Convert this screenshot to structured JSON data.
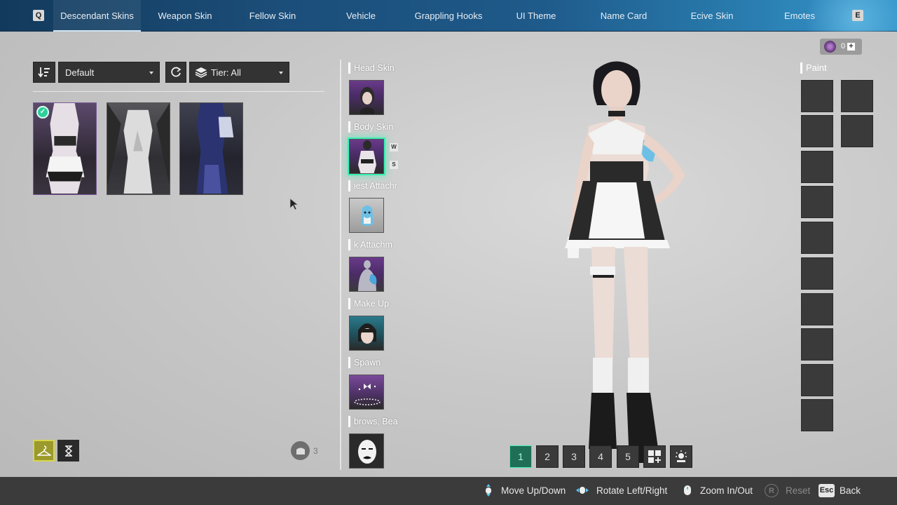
{
  "top_nav": {
    "left_key": "Q",
    "right_key": "E",
    "tabs": [
      {
        "label": "Descendant Skins",
        "active": true
      },
      {
        "label": "Weapon Skin",
        "active": false
      },
      {
        "label": "Fellow Skin",
        "active": false
      },
      {
        "label": "Vehicle",
        "active": false
      },
      {
        "label": "Grappling Hooks",
        "active": false
      },
      {
        "label": "UI Theme",
        "active": false
      },
      {
        "label": "Name Card",
        "active": false
      },
      {
        "label": "Ecive Skin",
        "active": false
      },
      {
        "label": "Emotes",
        "active": false
      }
    ]
  },
  "filters": {
    "sort_value": "Default",
    "tier_value": "Tier: All"
  },
  "skin_list": {
    "items": [
      {
        "icon": "maid-outfit-skin",
        "equipped": true
      },
      {
        "icon": "white-bodysuit-skin",
        "equipped": false
      },
      {
        "icon": "blue-armor-skin",
        "equipped": false
      }
    ]
  },
  "slots": {
    "head": {
      "label": "Head Skin"
    },
    "body": {
      "label": "Body Skin",
      "badge_w": "W",
      "badge_s": "S"
    },
    "chest": {
      "label": "iest Attachr"
    },
    "back": {
      "label": "k Attachm"
    },
    "makeup": {
      "label": "Make Up"
    },
    "spawn": {
      "label": "Spawn"
    },
    "brows": {
      "label": "brows, Bea"
    }
  },
  "currency": {
    "amount": "0"
  },
  "paint": {
    "label": "Paint"
  },
  "bottom_left": {
    "count": "3"
  },
  "presets": [
    "1",
    "2",
    "3",
    "4",
    "5"
  ],
  "footer": {
    "move": "Move Up/Down",
    "rotate": "Rotate Left/Right",
    "zoom": "Zoom In/Out",
    "reset_key": "R",
    "reset": "Reset",
    "back_key": "Esc",
    "back": "Back"
  },
  "colors": {
    "accent_green": "#3cf0b4",
    "nav_blue": "#1b4d78",
    "footer_bg": "#3b3b3b"
  }
}
